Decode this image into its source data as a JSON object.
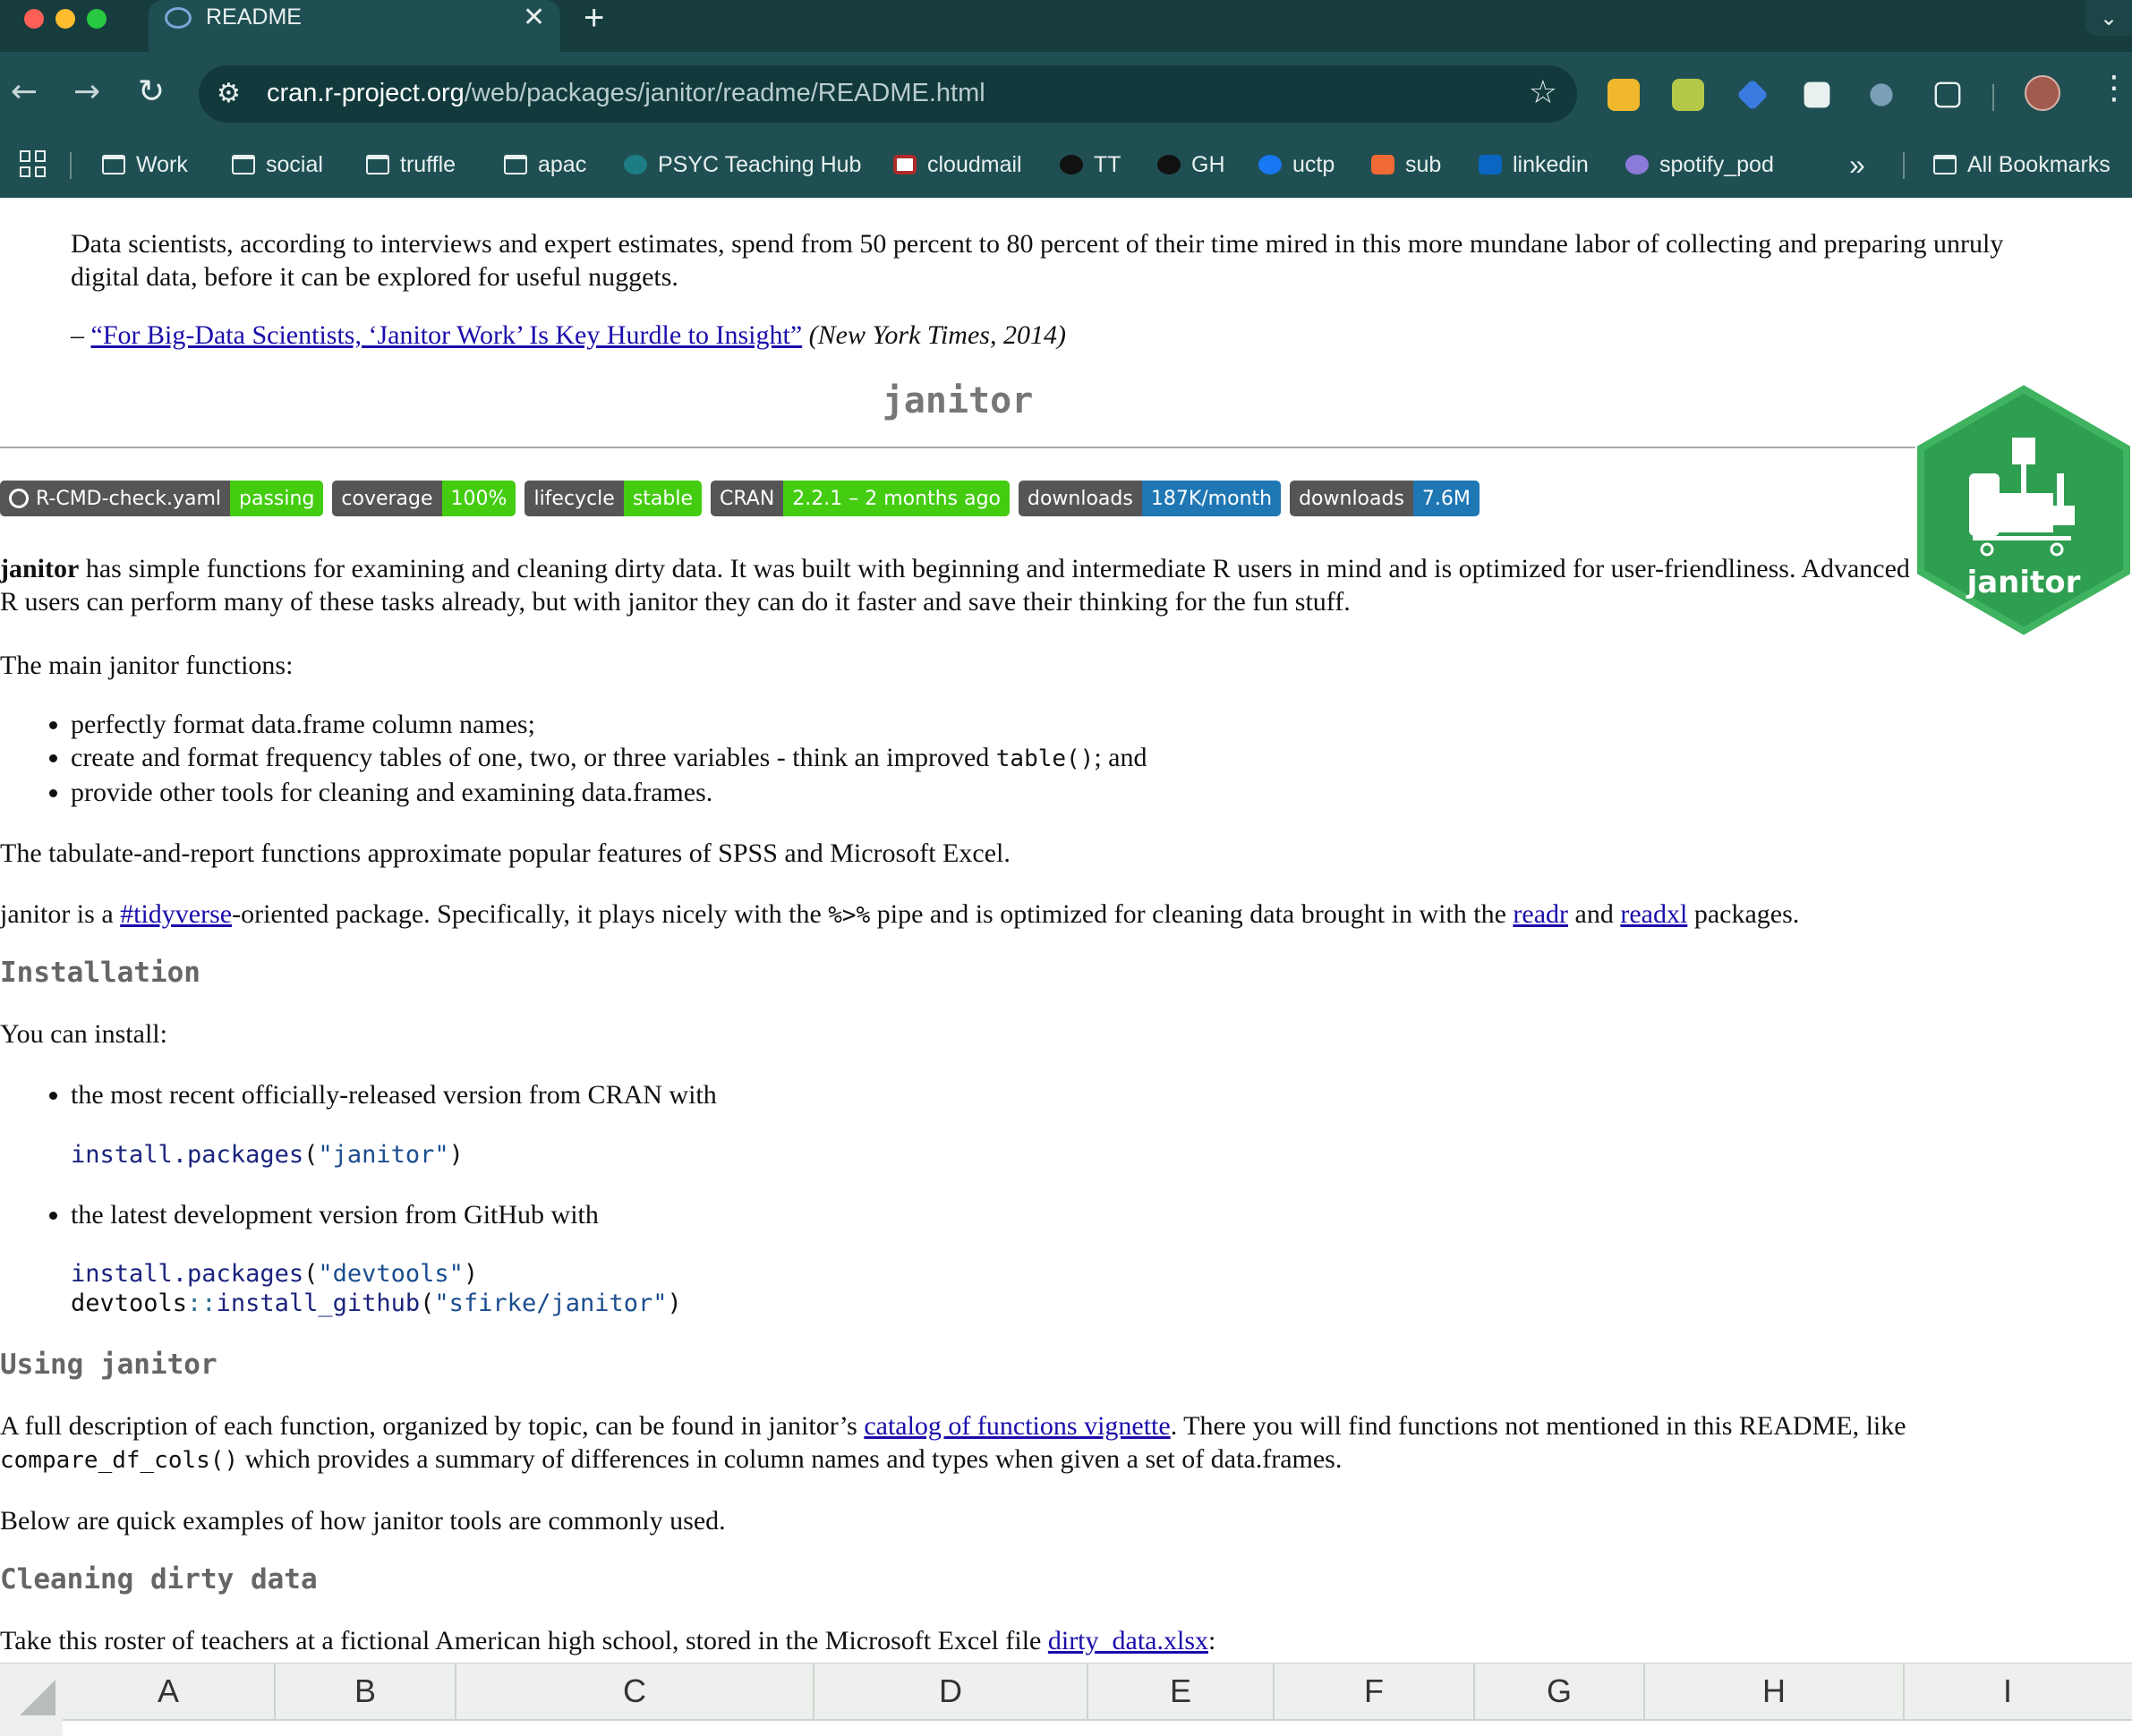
{
  "browser": {
    "tab_title": "README",
    "url_host": "cran.r-project.org",
    "url_path": "/web/packages/janitor/readme/README.html",
    "bookmarks": [
      {
        "label": "Work",
        "icon": "folder-icon"
      },
      {
        "label": "social",
        "icon": "folder-icon"
      },
      {
        "label": "truffle",
        "icon": "folder-icon"
      },
      {
        "label": "apac",
        "icon": "folder-icon"
      },
      {
        "label": "PSYC Teaching Hub",
        "icon": "sharepoint-icon"
      },
      {
        "label": "cloudmail",
        "icon": "cloudmail-icon"
      },
      {
        "label": "TT",
        "icon": "github-icon"
      },
      {
        "label": "GH",
        "icon": "github-icon"
      },
      {
        "label": "uctp",
        "icon": "facebook-icon"
      },
      {
        "label": "sub",
        "icon": "bookmark-icon"
      },
      {
        "label": "linkedin",
        "icon": "linkedin-icon"
      },
      {
        "label": "spotify_pod",
        "icon": "spotify-icon"
      }
    ],
    "more_bookmarks": "»",
    "all_bookmarks": "All Bookmarks"
  },
  "readme": {
    "quote": "Data scientists, according to interviews and expert estimates, spend from 50 percent to 80 percent of their time mired in this more mundane labor of collecting and preparing unruly digital data, before it can be explored for useful nuggets.",
    "quote_dash": "– ",
    "quote_link": "“For Big-Data Scientists, ‘Janitor Work’ Is Key Hurdle to Insight”",
    "quote_source": " (New York Times, 2014)",
    "title": "janitor",
    "logo_text": "janitor",
    "badges": [
      {
        "label": "R-CMD-check.yaml",
        "value": "passing",
        "color": "#4c1"
      },
      {
        "label": "coverage",
        "value": "100%",
        "color": "#4c1"
      },
      {
        "label": "lifecycle",
        "value": "stable",
        "color": "#4c1"
      },
      {
        "label": "CRAN",
        "value": "2.2.1 – 2 months ago",
        "color": "#4c1"
      },
      {
        "label": "downloads",
        "value": "187K/month",
        "color": "#1f77b4"
      },
      {
        "label": "downloads",
        "value": "7.6M",
        "color": "#1f77b4"
      }
    ],
    "intro_bold": "janitor",
    "intro_rest": " has simple functions for examining and cleaning dirty data. It was built with beginning and intermediate R users in mind and is optimized for user-friendliness. Advanced R users can perform many of these tasks already, but with janitor they can do it faster and save their thinking for the fun stuff.",
    "main_functions_intro": "The main janitor functions:",
    "main_functions": {
      "item1": "perfectly format data.frame column names;",
      "item2_pre": "create and format frequency tables of one, two, or three variables - think an improved ",
      "item2_code": "table()",
      "item2_post": "; and",
      "item3": "provide other tools for cleaning and examining data.frames."
    },
    "tabulate": "The tabulate-and-report functions approximate popular features of SPSS and Microsoft Excel.",
    "tidy_pre": "janitor is a ",
    "tidy_link": "#tidyverse",
    "tidy_mid": "-oriented package. Specifically, it plays nicely with the ",
    "tidy_code": "%>%",
    "tidy_mid2": " pipe and is optimized for cleaning data brought in with the ",
    "tidy_readr": "readr",
    "tidy_and": " and ",
    "tidy_readxl": "readxl",
    "tidy_post": " packages.",
    "installation_heading": "Installation",
    "install_intro": "You can install:",
    "install_cran": "the most recent officially-released version from CRAN with",
    "code_cran_fn": "install.packages",
    "code_cran_arg": "\"janitor\"",
    "install_github": "the latest development version from GitHub with",
    "code_dev_fn": "install.packages",
    "code_dev_arg": "\"devtools\"",
    "code_gh_ns": "devtools",
    "code_gh_op": "::",
    "code_gh_fn": "install_github",
    "code_gh_arg": "\"sfirke/janitor\"",
    "using_heading": "Using janitor",
    "using_pre": "A full description of each function, organized by topic, can be found in janitor’s ",
    "using_link": "catalog of functions vignette",
    "using_mid": ". There you will find functions not mentioned in this README, like ",
    "using_code": "compare_df_cols()",
    "using_post": " which provides a summary of differences in column names and types when given a set of data.frames.",
    "examples": "Below are quick examples of how janitor tools are commonly used.",
    "cleaning_heading": "Cleaning dirty data",
    "roster_pre": "Take this roster of teachers at a fictional American high school, stored in the Microsoft Excel file ",
    "roster_link": "dirty_data.xlsx",
    "roster_post": ":",
    "sheet_columns": [
      "A",
      "B",
      "C",
      "D",
      "E",
      "F",
      "G",
      "H",
      "I"
    ]
  }
}
